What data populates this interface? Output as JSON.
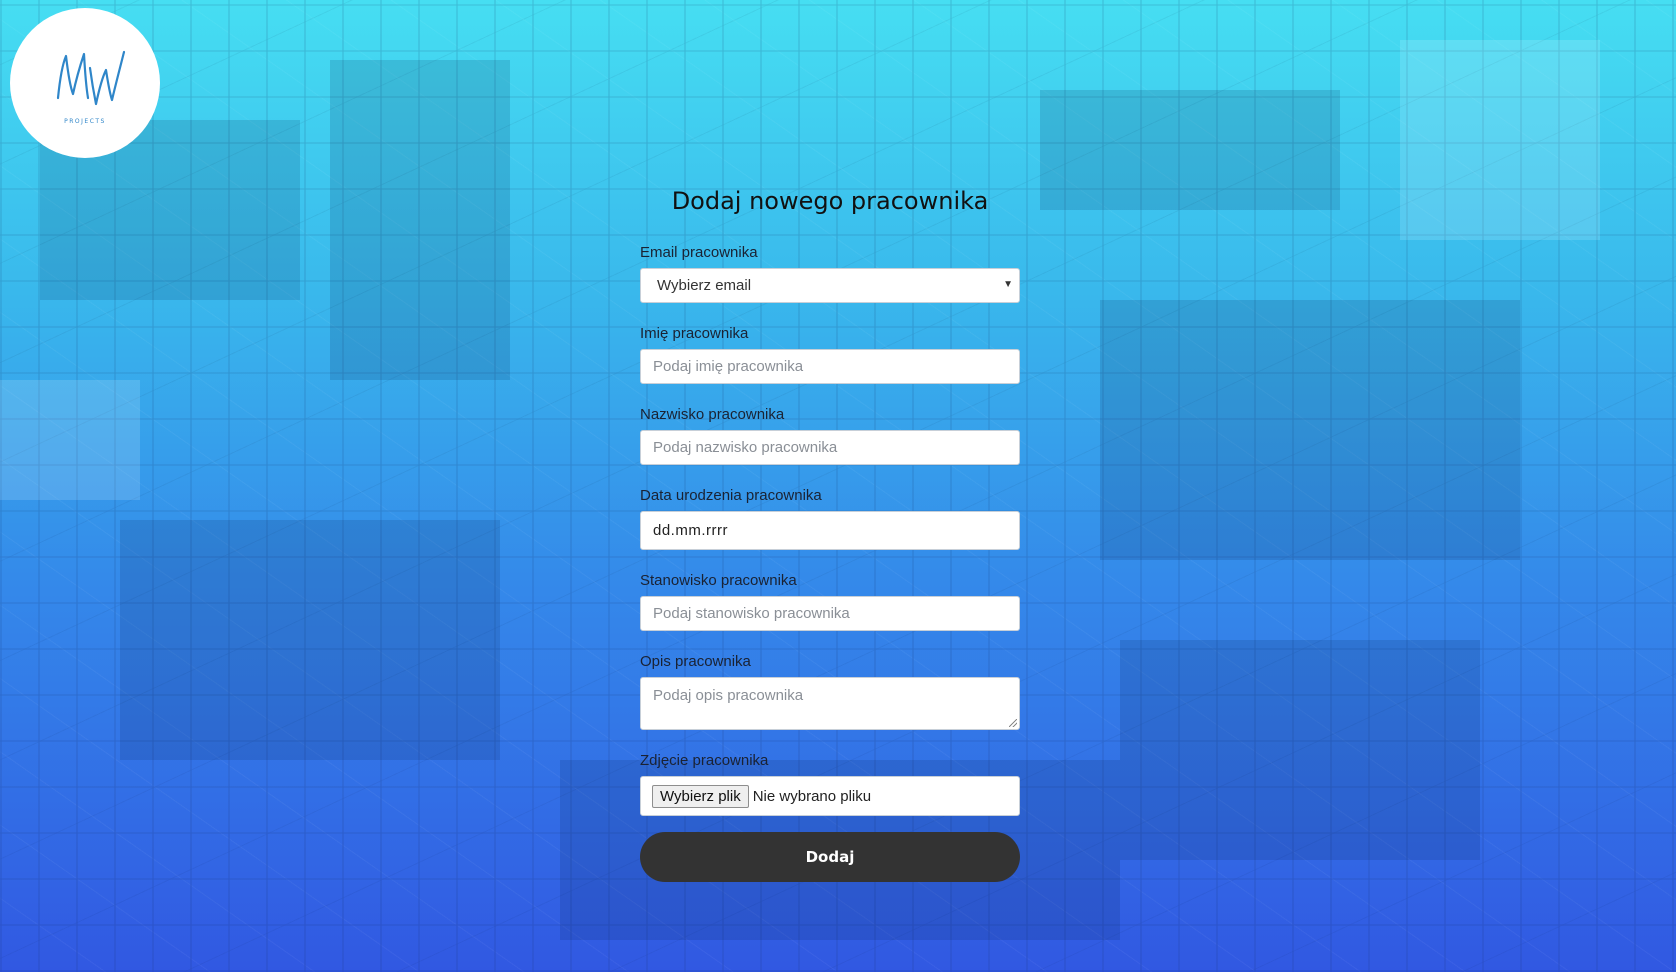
{
  "logo": {
    "monogram": "MW",
    "subtitle": "PROJECTS",
    "icon": "mw-projects-logo"
  },
  "form": {
    "title": "Dodaj nowego pracownika",
    "email": {
      "label": "Email pracownika",
      "selected": "Wybierz email",
      "icon": "dropdown-arrow-icon"
    },
    "first_name": {
      "label": "Imię pracownika",
      "placeholder": "Podaj imię pracownika"
    },
    "last_name": {
      "label": "Nazwisko pracownika",
      "placeholder": "Podaj nazwisko pracownika"
    },
    "birth_date": {
      "label": "Data urodzenia pracownika",
      "value": "dd.mm.rrrr"
    },
    "position": {
      "label": "Stanowisko pracownika",
      "placeholder": "Podaj stanowisko pracownika"
    },
    "description": {
      "label": "Opis pracownika",
      "placeholder": "Podaj opis pracownika"
    },
    "photo": {
      "label": "Zdjęcie pracownika",
      "button": "Wybierz plik",
      "status": "Nie wybrano pliku"
    },
    "submit": "Dodaj"
  },
  "colors": {
    "gradient_top": "#46def2",
    "gradient_bottom": "#3158e2",
    "button": "#333333",
    "logo_stroke": "#2f86c9"
  }
}
